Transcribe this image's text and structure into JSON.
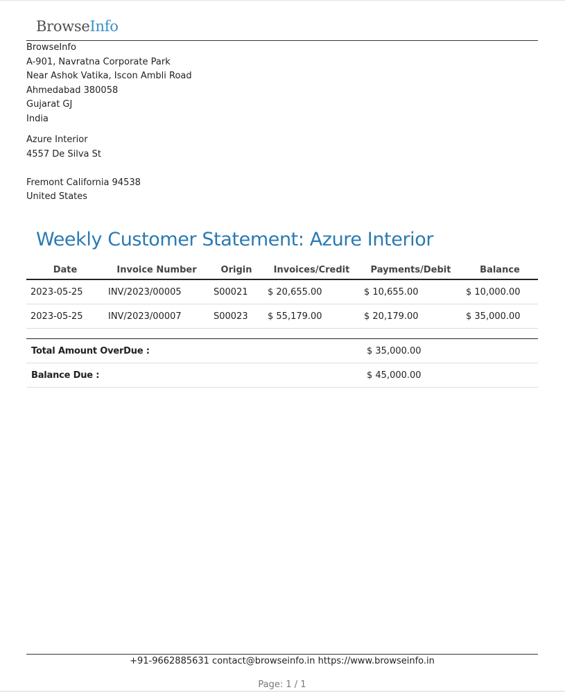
{
  "logo": {
    "part1": "Browse",
    "part2": "Info"
  },
  "company": {
    "lines": [
      "BrowseInfo",
      "A-901, Navratna Corporate Park",
      "Near Ashok Vatika, Iscon Ambli Road",
      "Ahmedabad 380058",
      "Gujarat GJ",
      "India"
    ]
  },
  "customer": {
    "lines": [
      "Azure Interior",
      "4557 De Silva St",
      "",
      "Fremont California 94538",
      "United States"
    ]
  },
  "title": "Weekly Customer Statement: Azure Interior",
  "table": {
    "headers": [
      "Date",
      "Invoice Number",
      "Origin",
      "Invoices/Credit",
      "Payments/Debit",
      "Balance"
    ],
    "rows": [
      [
        "2023-05-25",
        "INV/2023/00005",
        "S00021",
        "$ 20,655.00",
        "$ 10,655.00",
        "$ 10,000.00"
      ],
      [
        "2023-05-25",
        "INV/2023/00007",
        "S00023",
        "$ 55,179.00",
        "$ 20,179.00",
        "$ 35,000.00"
      ]
    ]
  },
  "summary": {
    "total_overdue_label": "Total Amount OverDue :",
    "total_overdue_value": "$ 35,000.00",
    "balance_due_label": "Balance Due :",
    "balance_due_value": "$ 45,000.00"
  },
  "footer": {
    "contact": "+91-9662885631 contact@browseinfo.in https://www.browseinfo.in",
    "page": "Page: 1 / 1"
  },
  "colors": {
    "title": "#2a7ab3",
    "logo_accent": "#3b8fc7"
  }
}
